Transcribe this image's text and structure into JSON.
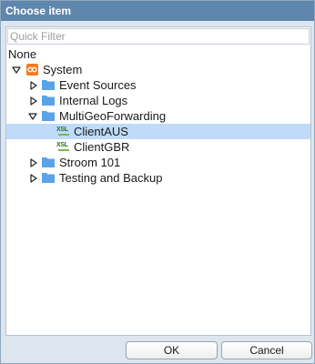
{
  "dialog": {
    "title": "Choose item"
  },
  "filter": {
    "placeholder": "Quick Filter"
  },
  "tree": {
    "none_label": "None",
    "system_label": "System",
    "items": [
      {
        "label": "Event Sources",
        "icon": "folder-icon",
        "expanded": false
      },
      {
        "label": "Internal Logs",
        "icon": "folder-icon",
        "expanded": false
      },
      {
        "label": "MultiGeoForwarding",
        "icon": "folder-icon",
        "expanded": true,
        "children": [
          {
            "label": "ClientAUS",
            "icon": "xslt-icon",
            "icon_text": "XSL",
            "selected": true
          },
          {
            "label": "ClientGBR",
            "icon": "xslt-icon",
            "icon_text": "XSL",
            "selected": false
          }
        ]
      },
      {
        "label": "Stroom 101",
        "icon": "folder-icon",
        "expanded": false
      },
      {
        "label": "Testing and Backup",
        "icon": "folder-icon",
        "expanded": false
      }
    ]
  },
  "buttons": {
    "ok_label": "OK",
    "cancel_label": "Cancel"
  },
  "colors": {
    "titlebar": "#5f86ac",
    "selection": "#bfdbf7",
    "folder": "#5ba3e8",
    "system_icon": "#f47a1f",
    "xsl_text": "#2a6e1f"
  }
}
